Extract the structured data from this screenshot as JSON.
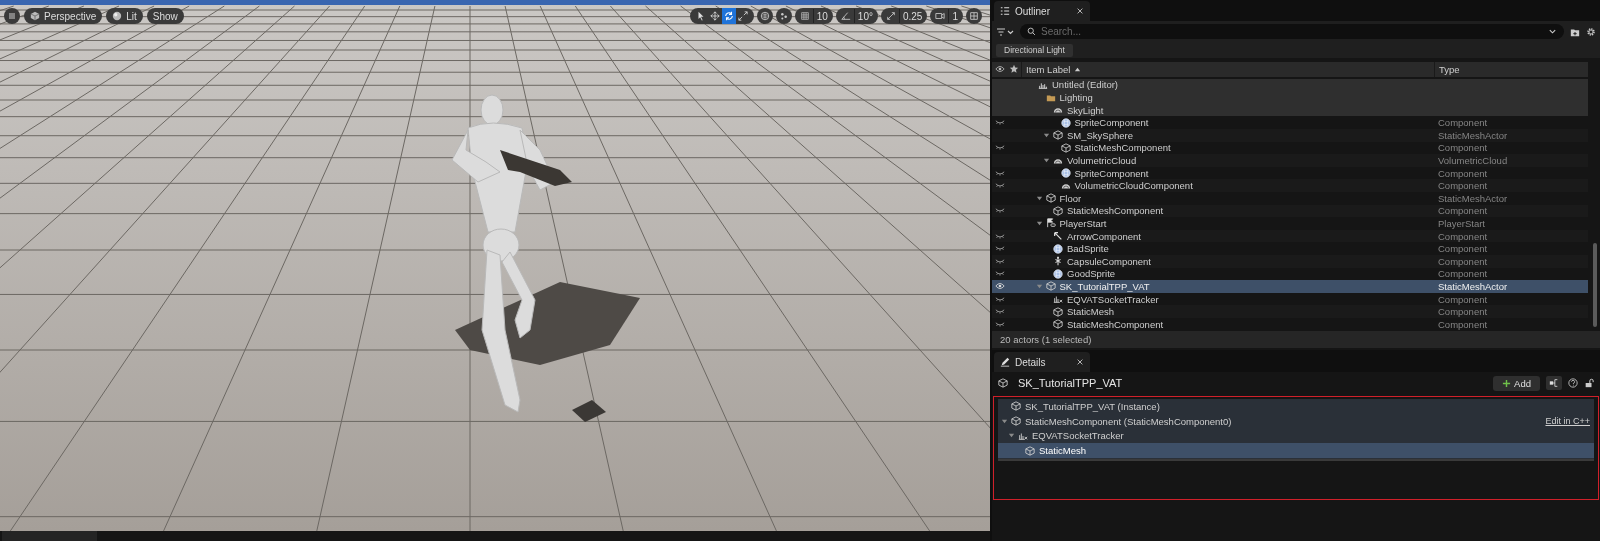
{
  "viewport": {
    "view_buttons": [
      {
        "kind": "perspective",
        "label": "Perspective"
      },
      {
        "kind": "lit",
        "label": "Lit"
      },
      {
        "kind": "show",
        "label": "Show"
      }
    ],
    "transform_tools": [
      {
        "kind": "select",
        "selected": false
      },
      {
        "kind": "move",
        "selected": false
      },
      {
        "kind": "rotate",
        "selected": true
      },
      {
        "kind": "scale",
        "selected": false
      }
    ],
    "snap_controls": [
      {
        "kind": "grid",
        "value": "10"
      },
      {
        "kind": "angle",
        "value": "10°"
      },
      {
        "kind": "scale",
        "value": "0.25"
      },
      {
        "kind": "camera",
        "value": "1"
      }
    ]
  },
  "outliner": {
    "tab": "Outliner",
    "search": {
      "placeholder": "Search..."
    },
    "filter_chip": "Directional Light",
    "columns": [
      "Item Label",
      "Type"
    ],
    "tree": [
      {
        "label": "Untitled (Editor)",
        "kind": "world",
        "highlighted": true,
        "selected": false,
        "children": [
          {
            "label": "Lighting",
            "kind": "folder",
            "highlighted": true,
            "selected": false,
            "children": [
              {
                "label": "SkyLight",
                "kind": "skylight",
                "highlighted": true,
                "selected": false,
                "children": [
                  {
                    "label": "SpriteComponent",
                    "type": "Component",
                    "kind": "sprite",
                    "visible": false,
                    "highlighted": false,
                    "selected": false
                  }
                ]
              },
              {
                "label": "SM_SkySphere",
                "type": "StaticMeshActor",
                "kind": "mesh",
                "expanded": true,
                "highlighted": false,
                "selected": false,
                "children": [
                  {
                    "label": "StaticMeshComponent",
                    "type": "Component",
                    "kind": "mesh",
                    "visible": false,
                    "highlighted": false,
                    "selected": false
                  }
                ]
              },
              {
                "label": "VolumetricCloud",
                "type": "VolumetricCloud",
                "kind": "cloud",
                "expanded": true,
                "highlighted": false,
                "selected": false,
                "children": [
                  {
                    "label": "SpriteComponent",
                    "type": "Component",
                    "kind": "sprite",
                    "visible": false,
                    "highlighted": false,
                    "selected": false
                  },
                  {
                    "label": "VolumetricCloudComponent",
                    "type": "Component",
                    "kind": "cloud",
                    "visible": false,
                    "highlighted": false,
                    "selected": false
                  }
                ]
              }
            ]
          },
          {
            "label": "Floor",
            "type": "StaticMeshActor",
            "kind": "mesh",
            "expanded": true,
            "highlighted": false,
            "selected": false,
            "children": [
              {
                "label": "StaticMeshComponent",
                "type": "Component",
                "kind": "mesh",
                "visible": false,
                "highlighted": false,
                "selected": false
              }
            ]
          },
          {
            "label": "PlayerStart",
            "type": "PlayerStart",
            "kind": "playerstart",
            "expanded": true,
            "highlighted": false,
            "selected": false,
            "children": [
              {
                "label": "ArrowComponent",
                "type": "Component",
                "kind": "arrow",
                "visible": false,
                "highlighted": false,
                "selected": false
              },
              {
                "label": "BadSprite",
                "type": "Component",
                "kind": "sprite",
                "visible": false,
                "highlighted": false,
                "selected": false
              },
              {
                "label": "CapsuleComponent",
                "type": "Component",
                "kind": "capsule",
                "visible": false,
                "highlighted": false,
                "selected": false
              },
              {
                "label": "GoodSprite",
                "type": "Component",
                "kind": "sprite",
                "visible": false,
                "highlighted": false,
                "selected": false
              }
            ]
          },
          {
            "label": "SK_TutorialTPP_VAT",
            "type": "StaticMeshActor",
            "kind": "mesh",
            "expanded": true,
            "visible": true,
            "highlighted": false,
            "selected": true,
            "children": [
              {
                "label": "EQVATSocketTracker",
                "type": "Component",
                "kind": "tracker",
                "visible": false,
                "highlighted": false,
                "selected": false
              },
              {
                "label": "StaticMesh",
                "type": "Component",
                "kind": "mesh",
                "visible": false,
                "highlighted": false,
                "selected": false
              },
              {
                "label": "StaticMeshComponent",
                "type": "Component",
                "kind": "mesh",
                "visible": false,
                "highlighted": false,
                "selected": false
              }
            ]
          }
        ]
      }
    ],
    "status": "20 actors (1 selected)"
  },
  "details": {
    "tab": "Details",
    "title": "SK_TutorialTPP_VAT",
    "add_button": "Add",
    "tree": [
      {
        "label": "SK_TutorialTPP_VAT (Instance)",
        "kind": "mesh",
        "selected": false
      },
      {
        "label": "StaticMeshComponent (StaticMeshComponent0)",
        "kind": "mesh",
        "expanded": true,
        "link": "Edit in C++",
        "selected": false,
        "children": [
          {
            "label": "EQVATSocketTracker",
            "kind": "tracker",
            "expanded": true,
            "selected": false,
            "children": [
              {
                "label": "StaticMesh",
                "kind": "mesh",
                "selected": true
              }
            ]
          }
        ]
      }
    ]
  }
}
